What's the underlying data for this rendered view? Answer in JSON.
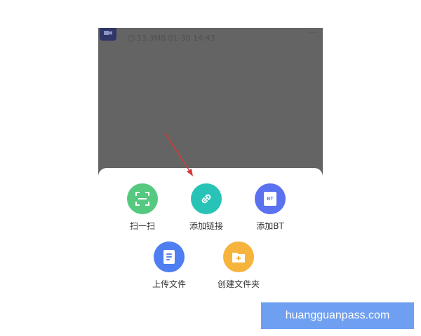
{
  "file": {
    "name": "",
    "size": "13.3MB",
    "date": "01-30 14:43",
    "thumb_icon": "video-icon",
    "thumb_color": "#2f3668"
  },
  "sheet": {
    "actions": [
      {
        "id": "scan",
        "label": "扫一扫",
        "icon": "scan-icon",
        "color": "#55c97f"
      },
      {
        "id": "link",
        "label": "添加链接",
        "icon": "link-icon",
        "color": "#28c3b7"
      },
      {
        "id": "bt",
        "label": "添加BT",
        "icon": "bt-icon",
        "icon_text": "BT",
        "color": "#5a71f0"
      },
      {
        "id": "upload",
        "label": "上传文件",
        "icon": "document-icon",
        "color": "#4e7ef0"
      },
      {
        "id": "folder",
        "label": "创建文件夹",
        "icon": "folder-plus-icon",
        "color": "#f6b43c"
      }
    ]
  },
  "annotation": {
    "arrow_color": "#d63a3a"
  },
  "watermark": {
    "text": "huangguanpass.com",
    "color": "#6f9ff0"
  }
}
